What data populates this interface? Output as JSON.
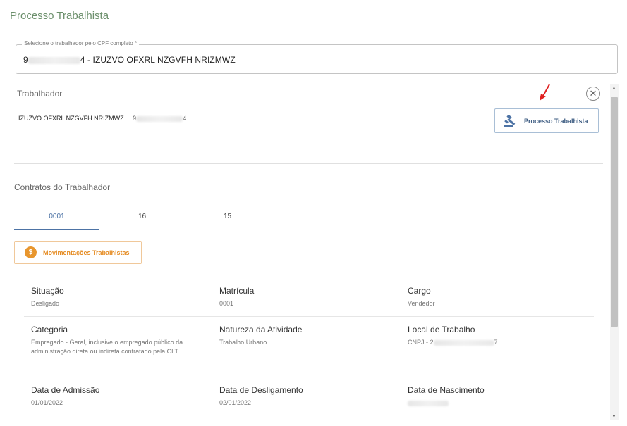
{
  "page": {
    "title": "Processo Trabalhista"
  },
  "cpf_field": {
    "legend": "Selecione o trabalhador pelo CPF completo *",
    "prefix": "9",
    "suffix": "4 - IZUZVO OFXRL NZGVFH NRIZMWZ"
  },
  "worker": {
    "section_title": "Trabalhador",
    "close_symbol": "✕",
    "name": "IZUZVO OFXRL NZGVFH NRIZMWZ",
    "cpf_prefix": "9",
    "cpf_suffix": "4",
    "processo_button_label": "Processo Trabalhista",
    "processo_button_icon": "gavel-icon"
  },
  "contracts": {
    "section_title": "Contratos do Trabalhador",
    "tabs": [
      {
        "label": "0001",
        "active": true
      },
      {
        "label": "16",
        "active": false
      },
      {
        "label": "15",
        "active": false
      }
    ],
    "movimentacoes_label": "Movimentações Trabalhistas",
    "movimentacoes_icon": "wallet-icon"
  },
  "details": {
    "situacao": {
      "label": "Situação",
      "value": "Desligado"
    },
    "matricula": {
      "label": "Matrícula",
      "value": "0001"
    },
    "cargo": {
      "label": "Cargo",
      "value": "Vendedor"
    },
    "categoria": {
      "label": "Categoria",
      "value": "Empregado - Geral, inclusive o empregado público da administração direta ou indireta contratado pela CLT"
    },
    "natureza": {
      "label": "Natureza da Atividade",
      "value": "Trabalho Urbano"
    },
    "local": {
      "label": "Local de Trabalho",
      "value_prefix": "CNPJ - 2",
      "value_suffix": "7"
    },
    "admissao": {
      "label": "Data de Admissão",
      "value": "01/01/2022"
    },
    "desligamento": {
      "label": "Data de Desligamento",
      "value": "02/01/2022"
    },
    "nascimento": {
      "label": "Data de Nascimento"
    }
  },
  "colors": {
    "accent": "#4d73a5",
    "orange": "#e8962e",
    "title_green": "#6b8f6b",
    "arrow_red": "#e02020"
  }
}
